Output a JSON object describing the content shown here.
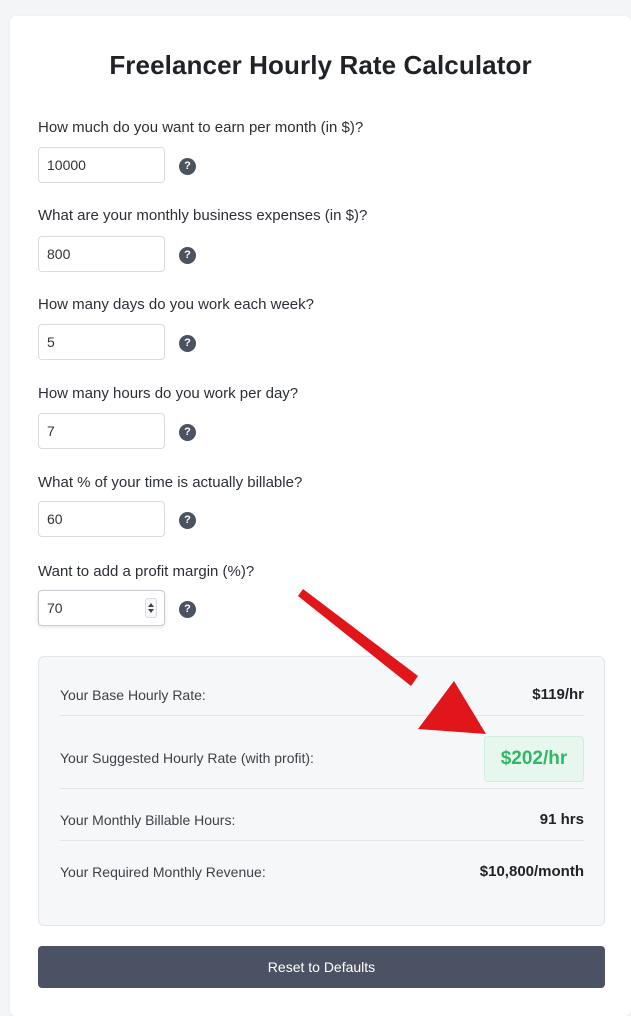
{
  "page_title": "Freelancer Hourly Rate Calculator",
  "fields": [
    {
      "label": "How much do you want to earn per month (in $)?",
      "value": "10000"
    },
    {
      "label": "What are your monthly business expenses (in $)?",
      "value": "800"
    },
    {
      "label": "How many days do you work each week?",
      "value": "5"
    },
    {
      "label": "How many hours do you work per day?",
      "value": "7"
    },
    {
      "label": "What % of your time is actually billable?",
      "value": "60"
    },
    {
      "label": "Want to add a profit margin (%)?",
      "value": "70"
    }
  ],
  "help_icon_glyph": "?",
  "results": {
    "base_rate": {
      "label": "Your Base Hourly Rate:",
      "value": "$119/hr"
    },
    "suggested_rate": {
      "label": "Your Suggested Hourly Rate (with profit):",
      "value": "$202/hr"
    },
    "billable_hours": {
      "label": "Your Monthly Billable Hours:",
      "value": "91 hrs"
    },
    "required_revenue": {
      "label": "Your Required Monthly Revenue:",
      "value": "$10,800/month"
    }
  },
  "reset_button_label": "Reset to Defaults",
  "colors": {
    "highlight_green": "#2fb867",
    "annotation_arrow": "#e0161b",
    "button_bg": "#4b5263"
  }
}
